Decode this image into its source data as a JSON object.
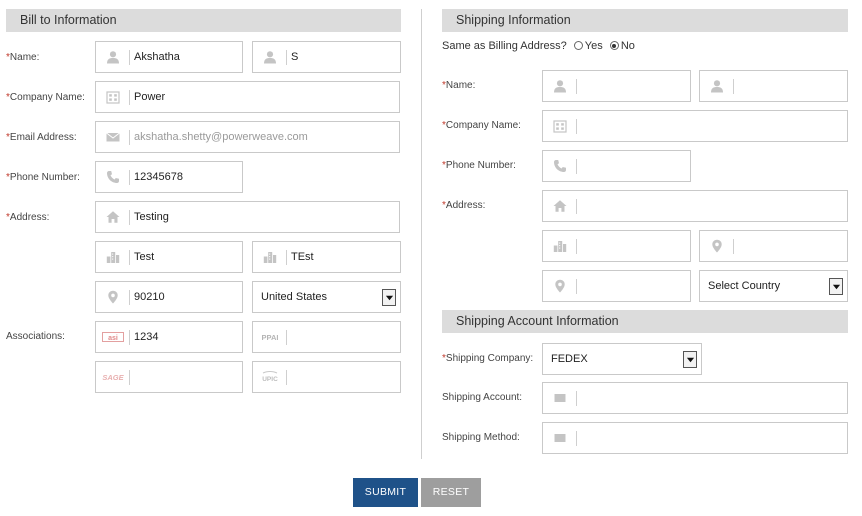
{
  "billing": {
    "header": "Bill to Information",
    "labels": {
      "name": "Name:",
      "company": "Company Name:",
      "email": "Email Address:",
      "phone": "Phone Number:",
      "address": "Address:",
      "associations": "Associations:"
    },
    "first_name": "Akshatha",
    "last_name": "S",
    "company": "Power",
    "email": "akshatha.shetty@powerweave.com",
    "phone": "12345678",
    "address1": "Testing",
    "address2": "Test",
    "city": "TEst",
    "zip": "90210",
    "country": "United States",
    "asi": "1234",
    "ppai": "",
    "sage": "",
    "upic": ""
  },
  "association_logos": {
    "asi": "asi",
    "ppai": "PPAI",
    "sage": "SAGE",
    "upic": "UPIC"
  },
  "shipping": {
    "header": "Shipping Information",
    "same_as_billing_label": "Same as Billing Address?",
    "yes_label": "Yes",
    "no_label": "No",
    "selected": "No",
    "labels": {
      "name": "Name:",
      "company": "Company Name:",
      "phone": "Phone Number:",
      "address": "Address:"
    },
    "country_placeholder": "Select Country"
  },
  "shipping_account": {
    "header": "Shipping Account Information",
    "labels": {
      "company": "Shipping Company:",
      "account": "Shipping Account:",
      "method": "Shipping Method:"
    },
    "company_value": "FEDEX"
  },
  "buttons": {
    "submit": "SUBMIT",
    "reset": "RESET"
  },
  "colors": {
    "header_bg": "#dcdcdc",
    "required": "#c0392b",
    "submit": "#1f5289",
    "reset": "#9e9e9e"
  }
}
